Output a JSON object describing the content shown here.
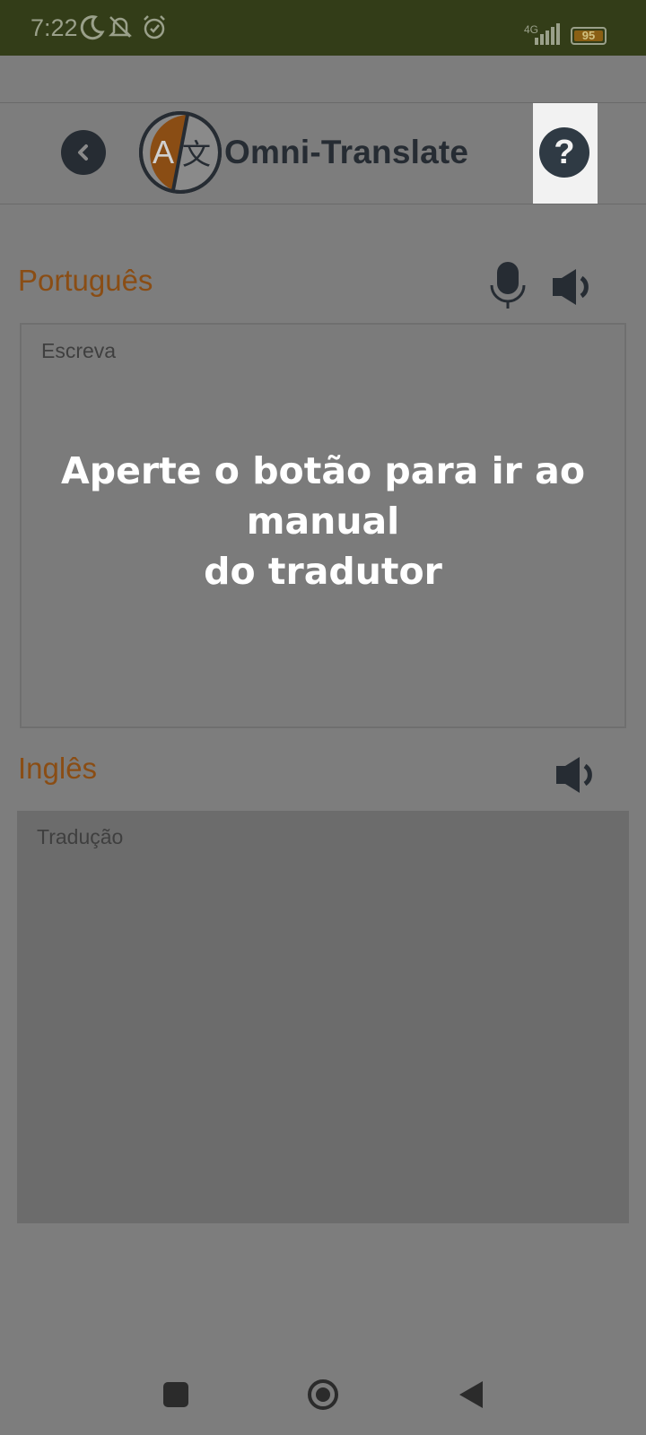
{
  "status_bar": {
    "time": "7:22",
    "network": "4G",
    "battery": "95",
    "icons": [
      "moon-icon",
      "bell-off-icon",
      "alarm-icon",
      "signal-icon",
      "battery-icon"
    ]
  },
  "app_bar": {
    "title": "Omni-Translate",
    "logo_letter": "A",
    "logo_glyph": "文",
    "back_icon": "chevron-left-icon",
    "help_icon": "question-icon",
    "help_glyph": "?"
  },
  "source": {
    "language": "Português",
    "placeholder": "Escreva",
    "icons": [
      "microphone-icon",
      "speaker-icon"
    ]
  },
  "target": {
    "language": "Inglês",
    "placeholder": "Tradução",
    "icons": [
      "speaker-icon"
    ]
  },
  "overlay": {
    "message_line1": "Aperte o botão para ir ao manual",
    "message_line2": "do tradutor"
  },
  "colors": {
    "accent": "#8a4d14",
    "status_bar": "#333d18",
    "dim_background": "#7d7d7d",
    "icon_dark": "#262c33"
  },
  "nav_bar": {
    "icons": [
      "recent-apps-icon",
      "home-icon",
      "back-triangle-icon"
    ]
  }
}
